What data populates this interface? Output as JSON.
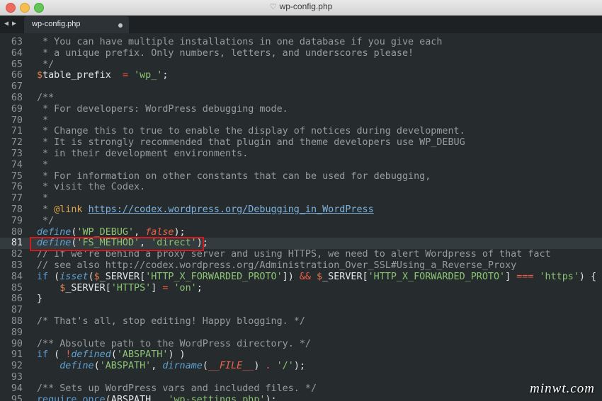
{
  "window": {
    "title": "wp-config.php",
    "title_icon": "document-icon"
  },
  "tab": {
    "label": "wp-config.php",
    "modified": true
  },
  "editor": {
    "current_line": 81,
    "lines": [
      {
        "n": "63",
        "t": [
          [
            "c",
            " * You can have multiple installations in one database if you give each"
          ]
        ]
      },
      {
        "n": "64",
        "t": [
          [
            "c",
            " * a unique prefix. Only numbers, letters, and underscores please!"
          ]
        ]
      },
      {
        "n": "65",
        "t": [
          [
            "c",
            " */"
          ]
        ]
      },
      {
        "n": "66",
        "t": [
          [
            "v",
            "$"
          ],
          [
            "pl",
            "table_prefix  "
          ],
          [
            "pm",
            "="
          ],
          [
            "pl",
            " "
          ],
          [
            "s",
            "'wp_'"
          ],
          [
            "pl",
            ";"
          ]
        ]
      },
      {
        "n": "67",
        "t": []
      },
      {
        "n": "68",
        "t": [
          [
            "c",
            "/**"
          ]
        ]
      },
      {
        "n": "69",
        "t": [
          [
            "c",
            " * For developers: WordPress debugging mode."
          ]
        ]
      },
      {
        "n": "70",
        "t": [
          [
            "c",
            " *"
          ]
        ]
      },
      {
        "n": "71",
        "t": [
          [
            "c",
            " * Change this to true to enable the display of notices during development."
          ]
        ]
      },
      {
        "n": "72",
        "t": [
          [
            "c",
            " * It is strongly recommended that plugin and theme developers use WP_DEBUG"
          ]
        ]
      },
      {
        "n": "73",
        "t": [
          [
            "c",
            " * in their development environments."
          ]
        ]
      },
      {
        "n": "74",
        "t": [
          [
            "c",
            " *"
          ]
        ]
      },
      {
        "n": "75",
        "t": [
          [
            "c",
            " * For information on other constants that can be used for debugging,"
          ]
        ]
      },
      {
        "n": "76",
        "t": [
          [
            "c",
            " * visit the Codex."
          ]
        ]
      },
      {
        "n": "77",
        "t": [
          [
            "c",
            " *"
          ]
        ]
      },
      {
        "n": "78",
        "t": [
          [
            "c",
            " * "
          ],
          [
            "at",
            "@link"
          ],
          [
            "c",
            " "
          ],
          [
            "u",
            "https://codex.wordpress.org/Debugging_in_WordPress"
          ]
        ]
      },
      {
        "n": "79",
        "t": [
          [
            "c",
            " */"
          ]
        ]
      },
      {
        "n": "80",
        "t": [
          [
            "f",
            "define"
          ],
          [
            "pl",
            "("
          ],
          [
            "s",
            "'WP_DEBUG'"
          ],
          [
            "pl",
            ", "
          ],
          [
            "cn",
            "false"
          ],
          [
            "pl",
            ");"
          ]
        ]
      },
      {
        "n": "81",
        "t": [
          [
            "f",
            "define"
          ],
          [
            "pl",
            "("
          ],
          [
            "s",
            "'FS_METHOD'"
          ],
          [
            "pl",
            ", "
          ],
          [
            "s",
            "'direct'"
          ],
          [
            "pl",
            ");"
          ]
        ]
      },
      {
        "n": "82",
        "t": [
          [
            "c",
            "// If we're behind a proxy server and using HTTPS, we need to alert Wordpress of that fact"
          ]
        ]
      },
      {
        "n": "83",
        "t": [
          [
            "c",
            "// see also http://codex.wordpress.org/Administration_Over_SSL#Using_a_Reverse_Proxy"
          ]
        ]
      },
      {
        "n": "84",
        "t": [
          [
            "k",
            "if"
          ],
          [
            "pl",
            " ("
          ],
          [
            "f",
            "isset"
          ],
          [
            "pl",
            "("
          ],
          [
            "v",
            "$"
          ],
          [
            "pl",
            "_SERVER["
          ],
          [
            "s",
            "'HTTP_X_FORWARDED_PROTO'"
          ],
          [
            "pl",
            "]) "
          ],
          [
            "pm",
            "&&"
          ],
          [
            "pl",
            " "
          ],
          [
            "v",
            "$"
          ],
          [
            "pl",
            "_SERVER["
          ],
          [
            "s",
            "'HTTP_X_FORWARDED_PROTO'"
          ],
          [
            "pl",
            "] "
          ],
          [
            "pm",
            "==="
          ],
          [
            "pl",
            " "
          ],
          [
            "s",
            "'https'"
          ],
          [
            "pl",
            ") {"
          ]
        ]
      },
      {
        "n": "85",
        "t": [
          [
            "pl",
            "    "
          ],
          [
            "v",
            "$"
          ],
          [
            "pl",
            "_SERVER["
          ],
          [
            "s",
            "'HTTPS'"
          ],
          [
            "pl",
            "] "
          ],
          [
            "pm",
            "="
          ],
          [
            "pl",
            " "
          ],
          [
            "s",
            "'on'"
          ],
          [
            "pl",
            ";"
          ]
        ]
      },
      {
        "n": "86",
        "t": [
          [
            "pl",
            "}"
          ]
        ]
      },
      {
        "n": "87",
        "t": []
      },
      {
        "n": "88",
        "t": [
          [
            "c",
            "/* That's all, stop editing! Happy blogging. */"
          ]
        ]
      },
      {
        "n": "89",
        "t": []
      },
      {
        "n": "90",
        "t": [
          [
            "c",
            "/** Absolute path to the WordPress directory. */"
          ]
        ]
      },
      {
        "n": "91",
        "t": [
          [
            "k",
            "if"
          ],
          [
            "pl",
            " ( "
          ],
          [
            "pm",
            "!"
          ],
          [
            "f",
            "defined"
          ],
          [
            "pl",
            "("
          ],
          [
            "s",
            "'ABSPATH'"
          ],
          [
            "pl",
            ") )"
          ]
        ]
      },
      {
        "n": "92",
        "t": [
          [
            "pl",
            "    "
          ],
          [
            "f",
            "define"
          ],
          [
            "pl",
            "("
          ],
          [
            "s",
            "'ABSPATH'"
          ],
          [
            "pl",
            ", "
          ],
          [
            "f",
            "dirname"
          ],
          [
            "pl",
            "("
          ],
          [
            "cn",
            "__FILE__"
          ],
          [
            "pl",
            ") "
          ],
          [
            "pm",
            "."
          ],
          [
            "pl",
            " "
          ],
          [
            "s",
            "'/'"
          ],
          [
            "pl",
            ");"
          ]
        ]
      },
      {
        "n": "93",
        "t": []
      },
      {
        "n": "94",
        "t": [
          [
            "c",
            "/** Sets up WordPress vars and included files. */"
          ]
        ]
      },
      {
        "n": "95",
        "t": [
          [
            "k",
            "require_once"
          ],
          [
            "pl",
            "(ABSPATH "
          ],
          [
            "pm",
            "."
          ],
          [
            "pl",
            " "
          ],
          [
            "s",
            "'wp-settings.php'"
          ],
          [
            "pl",
            ");"
          ]
        ]
      }
    ]
  },
  "watermark": "minwt.com",
  "colors": {
    "background": "#262b2d",
    "highlight_box": "#d51920"
  }
}
